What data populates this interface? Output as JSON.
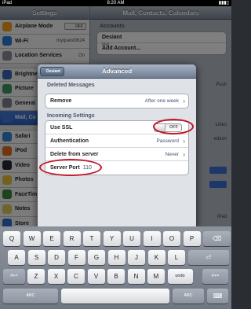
{
  "statusbar": {
    "device": "iPad",
    "time": "8:20 AM"
  },
  "left_pane": {
    "title": "Settings",
    "items": [
      {
        "label": "Airplane Mode",
        "toggle": "OFF",
        "color": "#f29f20"
      },
      {
        "label": "Wi-Fi",
        "value": "myquest0624",
        "color": "#2b7bd8"
      },
      {
        "label": "Location Services",
        "value": "On",
        "color": "#8a8f98"
      },
      {
        "label": "Brightne",
        "color": "#3c66b8"
      },
      {
        "label": "Picture",
        "color": "#3a9a5c"
      },
      {
        "label": "General",
        "color": "#7d8590"
      },
      {
        "label": "Mail, Co",
        "color": "#3e78d8"
      },
      {
        "label": "Safari",
        "color": "#2f84d6"
      },
      {
        "label": "iPod",
        "color": "#e56a1d"
      },
      {
        "label": "Video",
        "color": "#222a35"
      },
      {
        "label": "Photos",
        "color": "#e8c13a"
      },
      {
        "label": "FaceTim",
        "color": "#3a8a3a"
      },
      {
        "label": "Notes",
        "color": "#e0c85a"
      },
      {
        "label": "Store",
        "color": "#2f6fc8"
      }
    ]
  },
  "right_pane": {
    "title": "Mail, Contacts, Calendars",
    "accounts_header": "Accounts",
    "account_name": "Desiant",
    "account_sub": "Mail",
    "add_account": "Add Account...",
    "peeks": [
      "Push",
      "Lines",
      "edium",
      "iPad"
    ],
    "peek_on_count": 2
  },
  "modal": {
    "title": "Advanced",
    "back_label": "Desiant",
    "deleted_header": "Deleted Messages",
    "remove_label": "Remove",
    "remove_value": "After one week",
    "incoming_header": "Incoming Settings",
    "use_ssl_label": "Use SSL",
    "use_ssl_value": "OFF",
    "auth_label": "Authentication",
    "auth_value": "Password",
    "delete_label": "Delete from server",
    "delete_value": "Never",
    "port_label": "Server Port",
    "port_value": "110"
  },
  "keyboard": {
    "row1": [
      "Q",
      "W",
      "E",
      "R",
      "T",
      "Y",
      "U",
      "I",
      "O",
      "P"
    ],
    "row2": [
      "A",
      "S",
      "D",
      "F",
      "G",
      "H",
      "J",
      "K",
      "L"
    ],
    "row3": [
      "Z",
      "X",
      "C",
      "V",
      "B",
      "N",
      "M"
    ],
    "undo": "undo",
    "numbers": ".?123",
    "bottom_left": "#+=",
    "bottom_right": "#+=",
    "abc_left": "ABC",
    "abc_right": "ABC"
  }
}
